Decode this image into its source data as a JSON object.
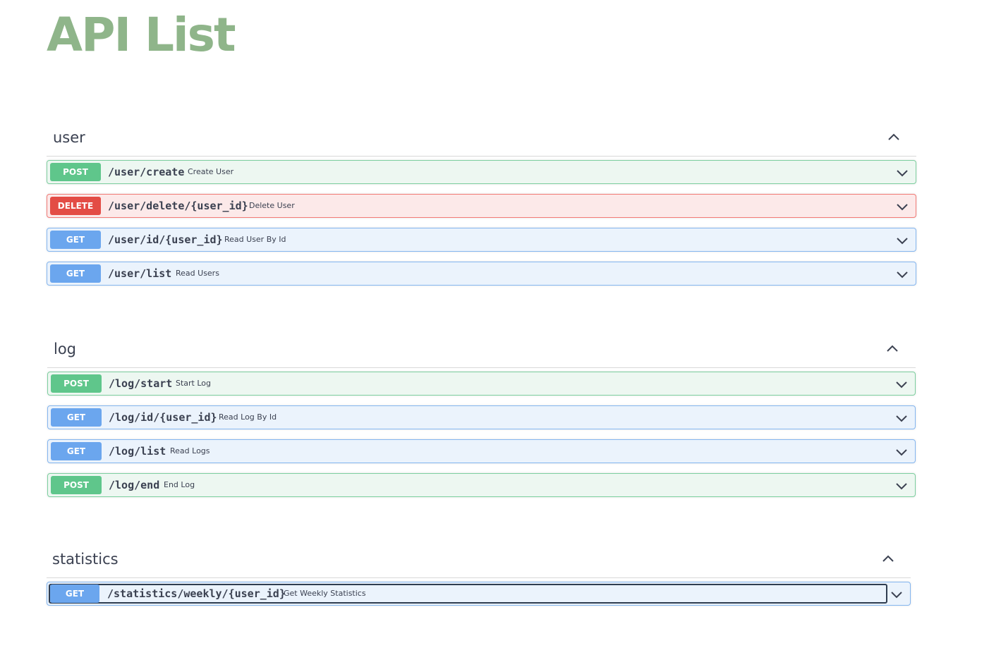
{
  "page": {
    "title": "API List"
  },
  "sections": [
    {
      "name": "user",
      "operations": [
        {
          "method": "POST",
          "path": "/user/create",
          "summary": "Create User"
        },
        {
          "method": "DELETE",
          "path": "/user/delete/{user_id}",
          "summary": "Delete User"
        },
        {
          "method": "GET",
          "path": "/user/id/{user_id}",
          "summary": "Read User By Id"
        },
        {
          "method": "GET",
          "path": "/user/list",
          "summary": "Read Users"
        }
      ]
    },
    {
      "name": "log",
      "operations": [
        {
          "method": "POST",
          "path": "/log/start",
          "summary": "Start Log"
        },
        {
          "method": "GET",
          "path": "/log/id/{user_id}",
          "summary": "Read Log By Id"
        },
        {
          "method": "GET",
          "path": "/log/list",
          "summary": "Read Logs"
        },
        {
          "method": "POST",
          "path": "/log/end",
          "summary": "End Log"
        }
      ]
    },
    {
      "name": "statistics",
      "operations": [
        {
          "method": "GET",
          "path": "/statistics/weekly/{user_id}",
          "summary": "Get Weekly Statistics"
        }
      ]
    }
  ],
  "colors": {
    "title": "#8fb58a",
    "post": "#5fc68b",
    "delete": "#e34c45",
    "get": "#6ba6ee"
  },
  "icons": {
    "section_toggle": "chevron-up-icon",
    "operation_toggle": "chevron-down-icon"
  }
}
